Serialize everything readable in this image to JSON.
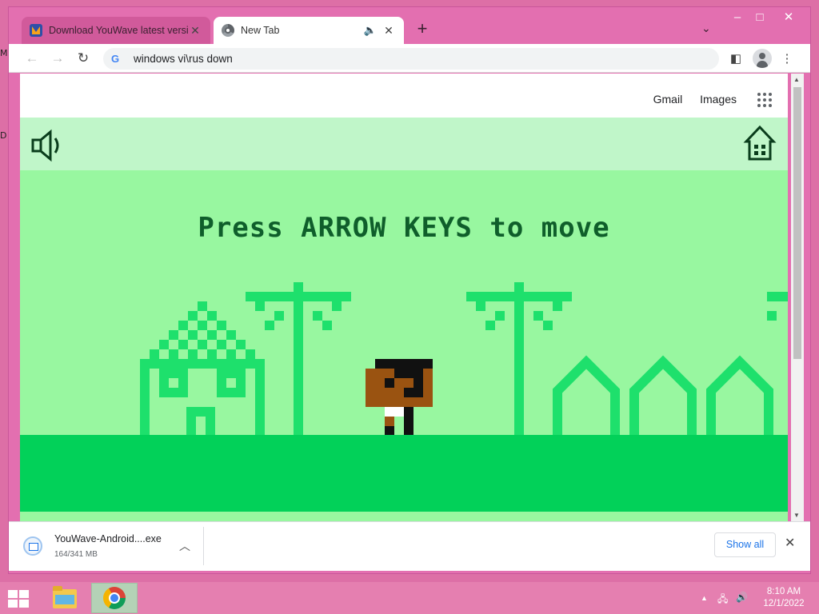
{
  "desktop": {
    "edge_glyph_top": "M",
    "edge_glyph_bottom": "D"
  },
  "browser": {
    "tabs": [
      {
        "title": "Download YouWave latest version",
        "favicon": "youwave-icon",
        "active": false
      },
      {
        "title": "New Tab",
        "favicon": "chrome-icon",
        "active": true,
        "audio": "speaker-icon"
      }
    ],
    "window_controls": {
      "minimize": "–",
      "maximize": "□",
      "close": "✕"
    },
    "toolbar": {
      "back": "←",
      "forward": "→",
      "reload": "↻",
      "address": "windows vi\\rus down"
    },
    "top_links": {
      "gmail": "Gmail",
      "images": "Images"
    }
  },
  "game": {
    "prompt": "Press ARROW KEYS to move",
    "colors": {
      "header": "#c0f6c9",
      "sky": "#98f7a0",
      "ground": "#02d159",
      "pixel": "#1ee06c",
      "text": "#0f5e2b"
    }
  },
  "downloads": {
    "items": [
      {
        "name": "YouWave-Android....exe",
        "progress": "164/341 MB"
      }
    ],
    "show_all": "Show all"
  },
  "taskbar": {
    "time": "8:10 AM",
    "date": "12/1/2022"
  }
}
